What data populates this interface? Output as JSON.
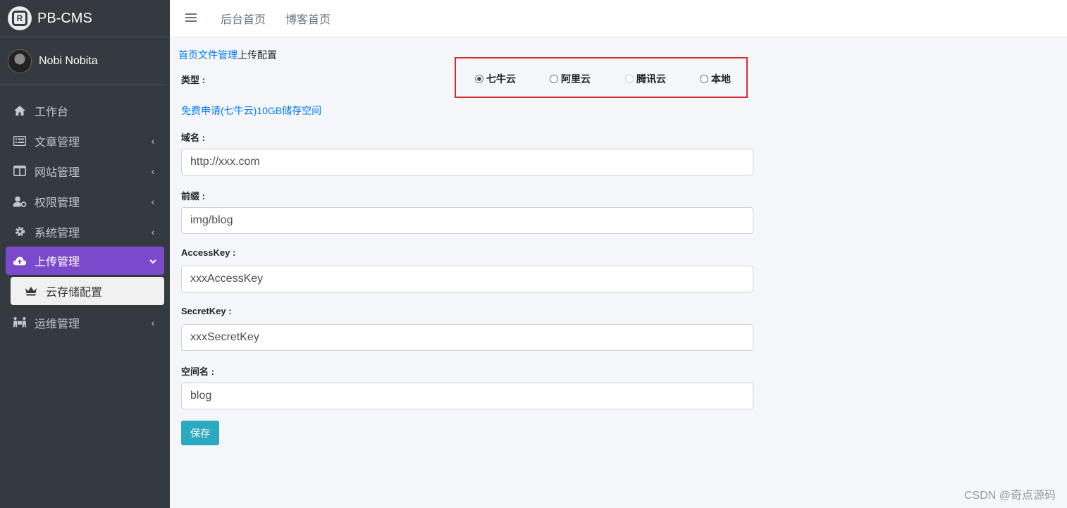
{
  "brand": {
    "name": "PB-CMS"
  },
  "user": {
    "name": "Nobi Nobita"
  },
  "sidebar": {
    "items": [
      {
        "label": "工作台"
      },
      {
        "label": "文章管理"
      },
      {
        "label": "网站管理"
      },
      {
        "label": "权限管理"
      },
      {
        "label": "系统管理"
      },
      {
        "label": "上传管理"
      },
      {
        "label": "运维管理"
      }
    ],
    "sub_items": [
      {
        "label": "云存储配置"
      }
    ]
  },
  "header": {
    "links": [
      {
        "label": "后台首页"
      },
      {
        "label": "博客首页"
      }
    ]
  },
  "breadcrumb": {
    "part1": "首页",
    "part2": "文件管理",
    "current": "上传配置"
  },
  "form": {
    "type_label": "类型 :",
    "type_options": [
      {
        "label": "七牛云",
        "checked": true
      },
      {
        "label": "阿里云",
        "checked": false
      },
      {
        "label": "腾讯云",
        "checked": false,
        "disabled": true
      },
      {
        "label": "本地",
        "checked": false
      }
    ],
    "free_link": "免费申请(七牛云)10GB储存空间",
    "domain_label": "域名 :",
    "domain_value": "http://xxx.com",
    "prefix_label": "前缀 :",
    "prefix_value": "img/blog",
    "access_key_label": "AccessKey :",
    "access_key_value": "xxxAccessKey",
    "secret_key_label": "SecretKey :",
    "secret_key_value": "xxxSecretKey",
    "bucket_label": "空间名 :",
    "bucket_value": "blog",
    "save_label": "保存"
  },
  "watermark": "CSDN @奇点源码",
  "colors": {
    "sidebar_bg": "#343a40",
    "active_item": "#7b49cc",
    "link": "#007bff",
    "save_button": "#2aa9c0",
    "highlight_border": "#d32f2f"
  }
}
